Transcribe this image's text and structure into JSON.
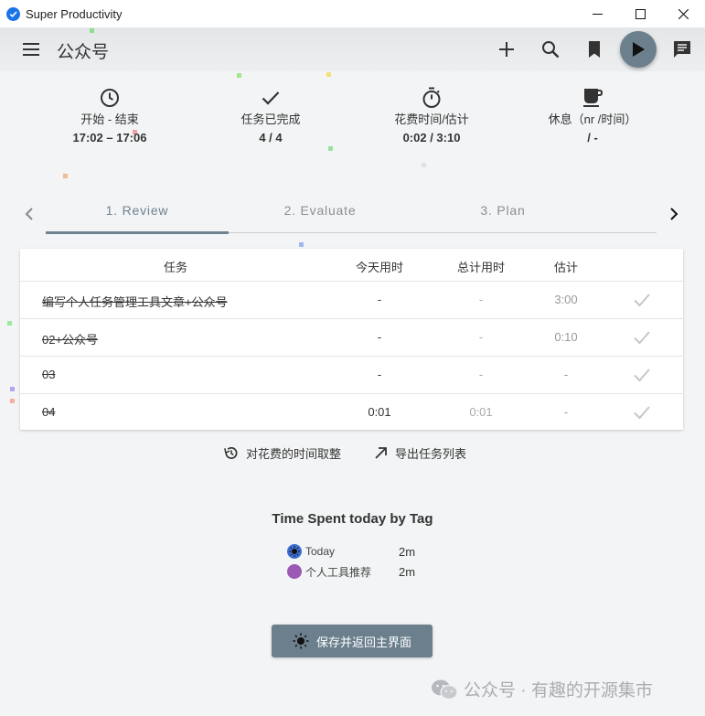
{
  "window": {
    "title": "Super Productivity"
  },
  "header": {
    "title": "公众号"
  },
  "stats": [
    {
      "icon": "clock-icon",
      "label": "开始 - 结束",
      "value": "17:02 – 17:06"
    },
    {
      "icon": "check-icon",
      "label": "任务已完成",
      "value": "4 / 4"
    },
    {
      "icon": "timer-icon",
      "label": "花费时间/估计",
      "value": "0:02 / 3:10"
    },
    {
      "icon": "coffee-icon",
      "label": "休息（nr /时间）",
      "value": "/ -"
    }
  ],
  "tabs": [
    {
      "label": "1. Review",
      "active": true
    },
    {
      "label": "2. Evaluate",
      "active": false
    },
    {
      "label": "3. Plan",
      "active": false
    }
  ],
  "table": {
    "headers": {
      "task": "任务",
      "today": "今天用时",
      "total": "总计用时",
      "estimate": "估计"
    },
    "rows": [
      {
        "name": "编写个人任务管理工具文章+公众号",
        "today": "-",
        "total": "-",
        "estimate": "3:00"
      },
      {
        "name": "02+公众号",
        "today": "-",
        "total": "-",
        "estimate": "0:10"
      },
      {
        "name": "03",
        "today": "-",
        "total": "-",
        "estimate": "-"
      },
      {
        "name": "04",
        "today": "0:01",
        "total": "0:01",
        "estimate": "-"
      }
    ]
  },
  "actions": {
    "round_time": "对花费的时间取整",
    "export_tasks": "导出任务列表"
  },
  "tags": {
    "title": "Time Spent today by Tag",
    "items": [
      {
        "name": "Today",
        "value": "2m",
        "color": "#3d6fd1"
      },
      {
        "name": "个人工具推荐",
        "value": "2m",
        "color": "#9b59b6"
      }
    ]
  },
  "save_button": {
    "label": "保存并返回主界面"
  },
  "watermark": {
    "text": "公众号 · 有趣的开源集市"
  },
  "colors": {
    "accent": "#6b7f8d",
    "tab_active": "#6f8290",
    "app_icon": "#1a73e8"
  }
}
